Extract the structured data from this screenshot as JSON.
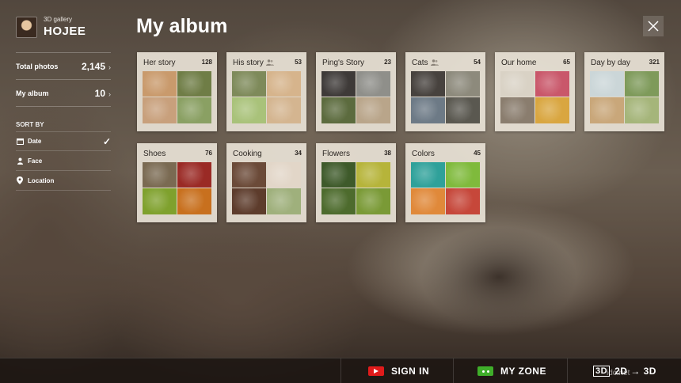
{
  "profile": {
    "gallery_label": "3D gallery",
    "user_name": "HOJEE"
  },
  "stats": {
    "total_photos_label": "Total photos",
    "total_photos_value": "2,145",
    "my_album_label": "My album",
    "my_album_value": "10"
  },
  "sort": {
    "title": "SORT BY",
    "items": [
      {
        "label": "Date",
        "icon": "calendar-icon",
        "selected": true
      },
      {
        "label": "Face",
        "icon": "person-icon",
        "selected": false
      },
      {
        "label": "Location",
        "icon": "pin-icon",
        "selected": false
      }
    ]
  },
  "header": {
    "title": "My album"
  },
  "albums": [
    {
      "name": "Her story",
      "count": "128",
      "people_icon": false,
      "colors": [
        "#c99a6c",
        "#6f7d46",
        "#c8a07c",
        "#8aa063"
      ]
    },
    {
      "name": "His story",
      "count": "53",
      "people_icon": true,
      "colors": [
        "#7e8a5a",
        "#d6b48c",
        "#a9c27a",
        "#d4b590"
      ]
    },
    {
      "name": "Ping's Story",
      "count": "23",
      "people_icon": false,
      "colors": [
        "#3e3a38",
        "#8f8f8a",
        "#5c6b3e",
        "#b9a58a"
      ]
    },
    {
      "name": "Cats",
      "count": "54",
      "people_icon": true,
      "colors": [
        "#47423e",
        "#8d8a7c",
        "#6d7a86",
        "#5a5850"
      ]
    },
    {
      "name": "Our home",
      "count": "65",
      "people_icon": false,
      "colors": [
        "#d9d2c5",
        "#c9576a",
        "#8a7d6e",
        "#d9a640"
      ]
    },
    {
      "name": "Day by day",
      "count": "321",
      "people_icon": false,
      "colors": [
        "#cbd6d8",
        "#7e9a5a",
        "#c9a77a",
        "#a5b57a"
      ]
    },
    {
      "name": "Shoes",
      "count": "76",
      "people_icon": false,
      "colors": [
        "#7a6a52",
        "#9a2a25",
        "#7fa12d",
        "#c8701e"
      ]
    },
    {
      "name": "Cooking",
      "count": "34",
      "people_icon": false,
      "colors": [
        "#6b4a38",
        "#e2d6c8",
        "#5d3c2c",
        "#9fb07c"
      ]
    },
    {
      "name": "Flowers",
      "count": "38",
      "people_icon": false,
      "colors": [
        "#3e5a2a",
        "#b6b43a",
        "#4d6b2d",
        "#7a9a36"
      ]
    },
    {
      "name": "Colors",
      "count": "45",
      "people_icon": false,
      "colors": [
        "#2fa19a",
        "#7fba3c",
        "#e0893a",
        "#c6473a"
      ]
    }
  ],
  "bottom": {
    "sign_in": "SIGN IN",
    "my_zone": "MY ZONE",
    "mode_icon": "3D",
    "mode_label": "2D → 3D",
    "watermark": "idc.net"
  },
  "colors": {
    "youtube_red": "#e01b1b",
    "zone_green": "#3fae2a"
  }
}
